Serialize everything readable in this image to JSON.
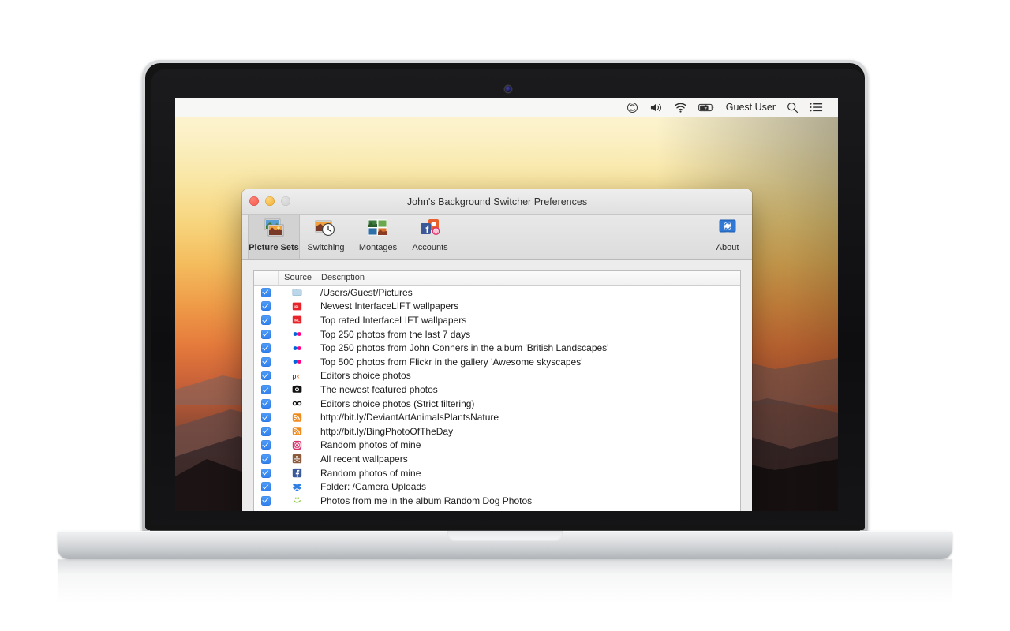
{
  "menubar": {
    "items": [
      {
        "name": "sync-icon",
        "glyph": "sync"
      },
      {
        "name": "volume-icon",
        "glyph": "volume"
      },
      {
        "name": "wifi-icon",
        "glyph": "wifi"
      },
      {
        "name": "battery-icon",
        "glyph": "battery"
      }
    ],
    "user": "Guest User",
    "search_icon": "search-icon",
    "notification_icon": "list-icon"
  },
  "window": {
    "title": "John's Background Switcher Preferences",
    "toolbar": {
      "items": [
        {
          "label": "Picture Sets",
          "icon": "picture-sets-icon",
          "selected": true
        },
        {
          "label": "Switching",
          "icon": "switching-clock-icon",
          "selected": false
        },
        {
          "label": "Montages",
          "icon": "montages-grid-icon",
          "selected": false
        },
        {
          "label": "Accounts",
          "icon": "accounts-icon",
          "selected": false
        }
      ],
      "about": {
        "label": "About",
        "icon": "about-icon"
      }
    },
    "table": {
      "headers": {
        "check": "",
        "source": "Source",
        "description": "Description"
      },
      "rows": [
        {
          "checked": true,
          "icon": "folder-icon",
          "description": "/Users/Guest/Pictures"
        },
        {
          "checked": true,
          "icon": "interfacelift-icon",
          "description": "Newest InterfaceLIFT wallpapers"
        },
        {
          "checked": true,
          "icon": "interfacelift-icon",
          "description": "Top rated InterfaceLIFT wallpapers"
        },
        {
          "checked": true,
          "icon": "flickr-icon",
          "description": "Top 250 photos from the last 7 days"
        },
        {
          "checked": true,
          "icon": "flickr-icon",
          "description": "Top 250 photos from John Conners in the album 'British Landscapes'"
        },
        {
          "checked": true,
          "icon": "flickr-icon",
          "description": "Top 500 photos from Flickr in the gallery 'Awesome skyscapes'"
        },
        {
          "checked": true,
          "icon": "fivehundredpx-icon",
          "description": "Editors choice photos"
        },
        {
          "checked": true,
          "icon": "camera-icon",
          "description": "The newest featured photos"
        },
        {
          "checked": true,
          "icon": "infinity-icon",
          "description": "Editors choice photos (Strict filtering)"
        },
        {
          "checked": true,
          "icon": "rss-icon",
          "description": "http://bit.ly/DeviantArtAnimalsPlantsNature"
        },
        {
          "checked": true,
          "icon": "rss-icon",
          "description": "http://bit.ly/BingPhotoOfTheDay"
        },
        {
          "checked": true,
          "icon": "instagram-icon",
          "description": "Random photos of mine"
        },
        {
          "checked": true,
          "icon": "deviantart-icon",
          "description": "All recent wallpapers"
        },
        {
          "checked": true,
          "icon": "facebook-icon",
          "description": "Random photos of mine"
        },
        {
          "checked": true,
          "icon": "dropbox-icon",
          "description": "Folder: /Camera Uploads"
        },
        {
          "checked": true,
          "icon": "smugmug-icon",
          "description": "Photos from me in the album Random Dog Photos"
        }
      ],
      "footer": {
        "add_label": "+",
        "add_chevron": "▾",
        "remove_label": "−"
      }
    }
  },
  "colors": {
    "accent_blue": "#2f7ff0",
    "interfacelift_red": "#e8242a",
    "flickr_blue": "#0063dc",
    "flickr_pink": "#ff0084",
    "rss_orange": "#f08a1c",
    "facebook_blue": "#3b5998",
    "dropbox_blue": "#2f7fe5",
    "smugmug_green": "#8cc63e",
    "deviantart_brown": "#8c5a3c",
    "px_orange": "#f47321"
  }
}
